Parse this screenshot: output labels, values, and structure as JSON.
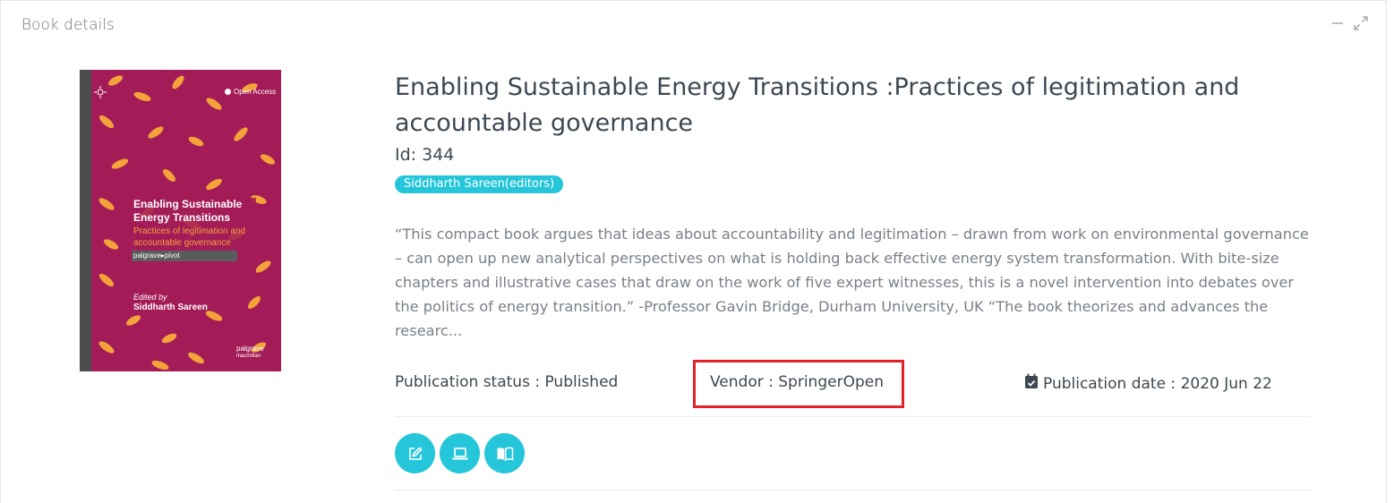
{
  "panel": {
    "title": "Book details"
  },
  "book": {
    "title": "Enabling Sustainable Energy Transitions :Practices of legitimation and accountable governance",
    "id_label": "Id: 344",
    "author_badge": "Siddharth Sareen(editors)",
    "description": "“This compact book argues that ideas about accountability and legitimation – drawn from work on environmental governance – can open up new analytical perspectives on what is holding back effective energy system transformation. With bite-size chapters and illustrative cases that draw on the work of five expert witnesses, this is a novel intervention into debates over the politics of energy transition.” -Professor Gavin Bridge, Durham University, UK “The book theorizes and advances the researc...",
    "publication_status": "Publication status : Published",
    "vendor": "Vendor : SpringerOpen",
    "publication_date": "Publication date : 2020 Jun 22"
  },
  "cover": {
    "open_access": "Open Access",
    "imprint": "palgrave▸pivot",
    "title_line1": "Enabling Sustainable",
    "title_line2": "Energy Transitions",
    "subtitle_line1": "Practices of legitimation and",
    "subtitle_line2": "accountable governance",
    "edited_by": "Edited by",
    "editor": "Siddharth Sareen",
    "publisher_line1": "palgrave",
    "publisher_line2": "macmillan"
  },
  "icons": {
    "minimize": "minimize-icon",
    "expand": "expand-icon",
    "calendar": "calendar-check-icon",
    "edit": "edit-icon",
    "laptop": "laptop-icon",
    "read": "book-open-icon"
  },
  "colors": {
    "accent": "#26c6da",
    "highlight": "#e0202a",
    "cover_bg": "#a31c57",
    "leaf": "#f4a23a"
  }
}
